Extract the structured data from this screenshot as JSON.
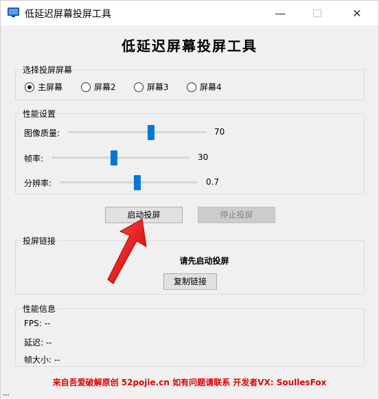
{
  "window": {
    "title": "低延迟屏幕投屏工具",
    "min_symbol": "—",
    "max_symbol": "☐",
    "close_symbol": "✕"
  },
  "heading": "低延迟屏幕投屏工具",
  "screen_select": {
    "title": "选择投屏屏幕",
    "options": [
      "主屏幕",
      "屏幕2",
      "屏幕3",
      "屏幕4"
    ],
    "selected": "主屏幕"
  },
  "performance": {
    "title": "性能设置",
    "sliders": [
      {
        "label": "图像质量:",
        "value_text": "70",
        "fraction": 0.6
      },
      {
        "label": "帧率:",
        "value_text": "30",
        "fraction": 0.45
      },
      {
        "label": "分辨率:",
        "value_text": "0.7",
        "fraction": 0.57
      }
    ]
  },
  "buttons": {
    "start": "启动投屏",
    "stop": "停止投屏"
  },
  "link": {
    "title": "投屏链接",
    "message": "请先启动投屏",
    "copy": "复制链接"
  },
  "info": {
    "title": "性能信息",
    "fps": "FPS: --",
    "latency": "延迟: --",
    "frame_size": "帧大小: --"
  },
  "footer": "来自吾爱破解原创 52pojie.cn 如有问题请联系 开发者VX: SoullesFox",
  "colors": {
    "accent": "#0078d7",
    "footer": "#e00000",
    "arrow": "#ff1a1a"
  }
}
